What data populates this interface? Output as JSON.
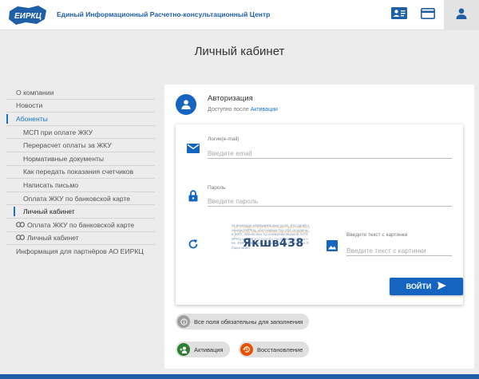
{
  "header": {
    "logo_text": "ЕИРКЦ",
    "org_name": "Единый Информационный Расчетно-консультационный Центр",
    "icons": [
      "contact-card-icon",
      "payment-card-icon",
      "user-icon"
    ]
  },
  "page_title": "Личный кабинет",
  "sidebar": {
    "items": [
      {
        "label": "О компании"
      },
      {
        "label": "Новости"
      },
      {
        "label": "Абоненты"
      },
      {
        "label": "МСП при оплате ЖКУ"
      },
      {
        "label": "Перерасчет оплаты за ЖКУ"
      },
      {
        "label": "Нормативные документы"
      },
      {
        "label": "Как передать показания счетчиков"
      },
      {
        "label": "Написать письмо"
      },
      {
        "label": "Оплата ЖКУ по банковской карте"
      },
      {
        "label": "Личный кабинет"
      },
      {
        "label": "Оплата ЖКУ по банковской карте"
      },
      {
        "label": "Личный кабинет"
      },
      {
        "label": "Информация для партнёров АО ЕИРКЦ"
      }
    ]
  },
  "auth": {
    "title": "Авторизация",
    "subtitle_prefix": "Доступно после",
    "subtitle_link": "Активации"
  },
  "form": {
    "login_label": "Логин(e-mail)",
    "login_placeholder": "Введите email",
    "password_label": "Пароль",
    "password_placeholder": "Введите пароль",
    "captcha_code": "Якшв438",
    "captcha_noise_1": "ка визнацде коммуникацкые услуг. итр одгий комнам ЕИРКЦ, оботочивые Гер 204 скодарный ЖКУ, лемчесных пр коммуниковцмной АО ЕИРКЦ мн кий и услуги по системне обслучш ния. ЕИРКЦ Единая мя Костромской области Общих мнен",
    "captcha_noise_2": "ри тесекдент ЕИРКЦ сообщает цкие квитанции тарифы область мнения рагиональный центр",
    "captcha_label": "Введите текст с картинки",
    "captcha_placeholder": "Введите текст с картинки",
    "login_button": "ВОЙТИ"
  },
  "chips": {
    "required": "Все поля обязательны для заполнения",
    "activation": "Активация",
    "recovery": "Восстановление"
  },
  "colors": {
    "brand_blue": "#1565c0",
    "link_blue": "#1a73c8",
    "activation_green": "#2e7d32",
    "recovery_orange": "#e65100"
  }
}
